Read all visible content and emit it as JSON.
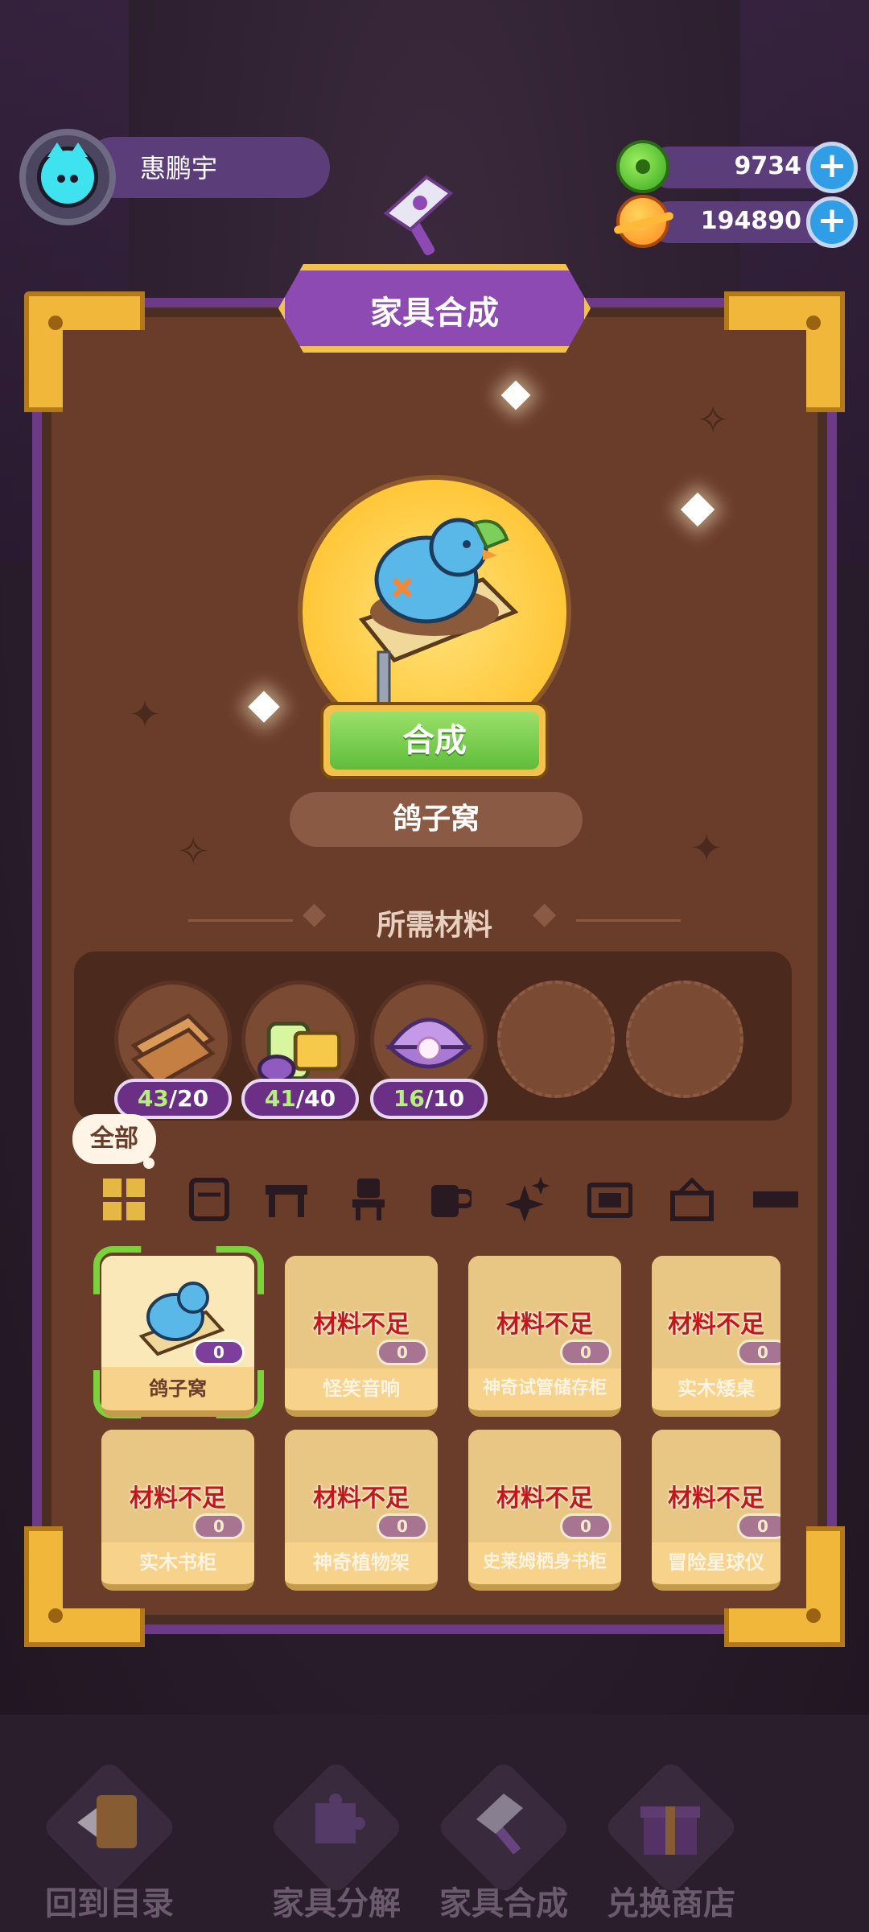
{
  "player": {
    "name": "惠鹏宇"
  },
  "currency": [
    {
      "icon": "green-coin-icon",
      "value": "9734"
    },
    {
      "icon": "orange-planet-coin-icon",
      "value": "194890"
    }
  ],
  "title": "家具合成",
  "featured": {
    "name": "鸽子窝",
    "action": "合成"
  },
  "materials_title": "所需材料",
  "materials": [
    {
      "icon": "wood-planks-icon",
      "have": "43",
      "need": "20"
    },
    {
      "icon": "cloth-rolls-icon",
      "have": "41",
      "need": "40"
    },
    {
      "icon": "pearl-shell-icon",
      "have": "16",
      "need": "10"
    },
    {
      "icon": "empty-slot",
      "have": "",
      "need": ""
    },
    {
      "icon": "empty-slot",
      "have": "",
      "need": ""
    }
  ],
  "category": {
    "selected_label": "全部",
    "icons": [
      "all-grid-icon",
      "cabinet-icon",
      "table-icon",
      "chair-icon",
      "mug-icon",
      "sparkle-icon",
      "frame-icon",
      "rug-icon",
      "shelf-icon"
    ]
  },
  "items": [
    {
      "name": "鸽子窝",
      "status": "",
      "qty": "0",
      "selected": true
    },
    {
      "name": "怪笑音响",
      "status": "材料不足",
      "qty": "0",
      "selected": false
    },
    {
      "name": "神奇试管储存柜",
      "status": "材料不足",
      "qty": "0",
      "selected": false
    },
    {
      "name": "实木矮桌",
      "status": "材料不足",
      "qty": "0",
      "selected": false
    },
    {
      "name": "实木书柜",
      "status": "材料不足",
      "qty": "0",
      "selected": false
    },
    {
      "name": "神奇植物架",
      "status": "材料不足",
      "qty": "0",
      "selected": false
    },
    {
      "name": "史莱姆栖身书柜",
      "status": "材料不足",
      "qty": "0",
      "selected": false
    },
    {
      "name": "冒险星球仪",
      "status": "材料不足",
      "qty": "0",
      "selected": false
    }
  ],
  "nav": [
    {
      "label": "回到目录",
      "icon": "back-book-icon"
    },
    {
      "label": "家具分解",
      "icon": "puzzle-icon"
    },
    {
      "label": "家具合成",
      "icon": "hammer-icon"
    },
    {
      "label": "兑换商店",
      "icon": "gift-icon"
    }
  ],
  "colors": {
    "panel_border": "#6d3a87",
    "panel_bg": "#6a3d2b",
    "gold": "#f0b73a",
    "accent_green": "#5fbd3a",
    "warning_red": "#c41818"
  }
}
